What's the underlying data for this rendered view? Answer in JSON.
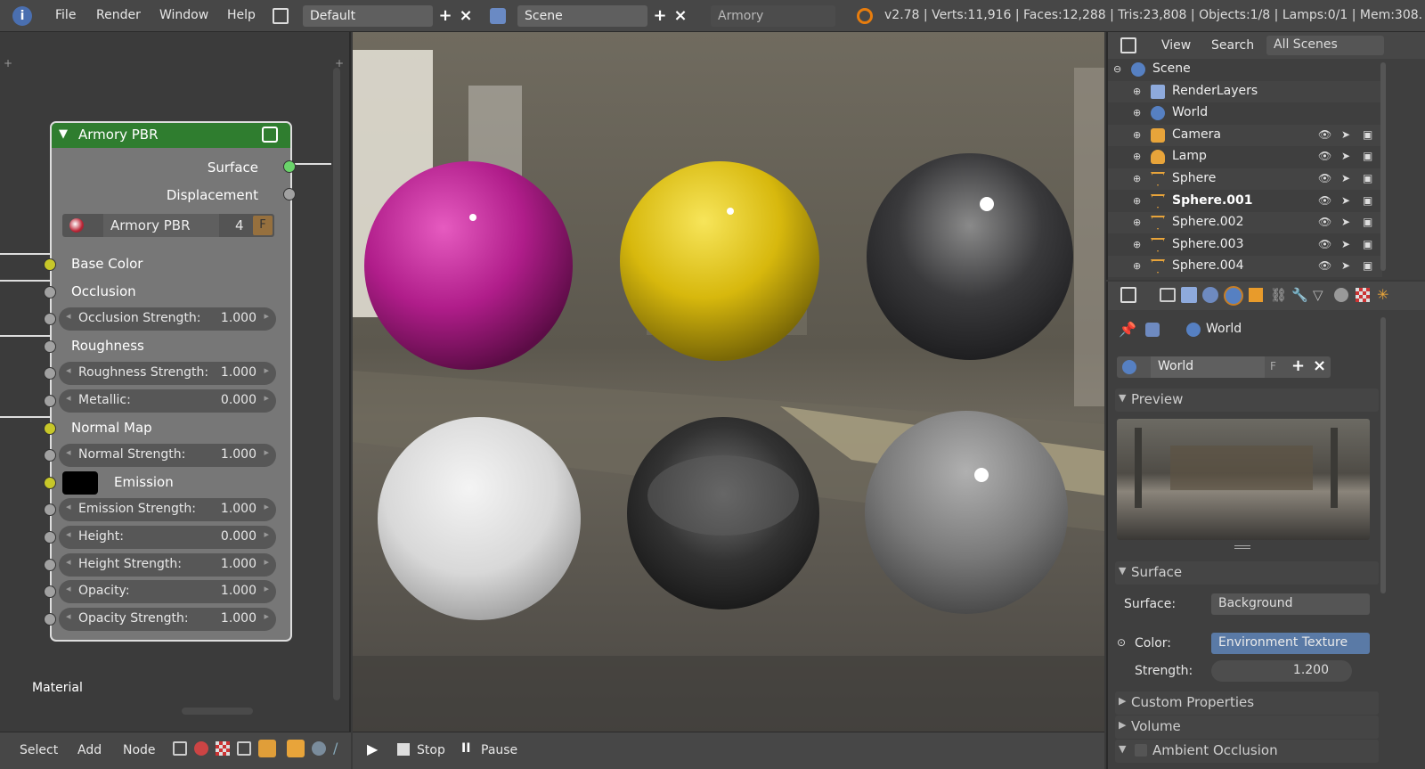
{
  "topbar": {
    "menus": [
      "File",
      "Render",
      "Window",
      "Help"
    ],
    "layout_name": "Default",
    "scene_name": "Scene",
    "engine": "Armory",
    "stats": "v2.78 | Verts:11,916 | Faces:12,288 | Tris:23,808 | Objects:1/8 | Lamps:0/1 | Mem:308."
  },
  "node": {
    "title": "Armory PBR",
    "outputs": [
      "Surface",
      "Displacement"
    ],
    "group_name": "Armory PBR",
    "group_users": "4",
    "fake_user": "F",
    "inputs": [
      {
        "label": "Base Color",
        "type": "socket"
      },
      {
        "label": "Occlusion",
        "type": "socket"
      },
      {
        "label": "Occlusion Strength:",
        "value": "1.000",
        "type": "field"
      },
      {
        "label": "Roughness",
        "type": "socket"
      },
      {
        "label": "Roughness Strength:",
        "value": "1.000",
        "type": "field"
      },
      {
        "label": "Metallic:",
        "value": "0.000",
        "type": "field"
      },
      {
        "label": "Normal Map",
        "type": "socket"
      },
      {
        "label": "Normal Strength:",
        "value": "1.000",
        "type": "field"
      },
      {
        "label": "Emission",
        "type": "color"
      },
      {
        "label": "Emission Strength:",
        "value": "1.000",
        "type": "field"
      },
      {
        "label": "Height:",
        "value": "0.000",
        "type": "field"
      },
      {
        "label": "Height Strength:",
        "value": "1.000",
        "type": "field"
      },
      {
        "label": "Opacity:",
        "value": "1.000",
        "type": "field"
      },
      {
        "label": "Opacity Strength:",
        "value": "1.000",
        "type": "field"
      }
    ],
    "frame_label": "Material"
  },
  "node_footer": {
    "menus": [
      "Select",
      "Add",
      "Node"
    ]
  },
  "viewport_footer": {
    "stop": "Stop",
    "pause": "Pause"
  },
  "outliner": {
    "menus": [
      "View",
      "Search",
      "All Scenes"
    ],
    "rows": [
      {
        "name": "Scene"
      },
      {
        "name": "RenderLayers"
      },
      {
        "name": "World"
      },
      {
        "name": "Camera"
      },
      {
        "name": "Lamp"
      },
      {
        "name": "Sphere"
      },
      {
        "name": "Sphere.001"
      },
      {
        "name": "Sphere.002"
      },
      {
        "name": "Sphere.003"
      },
      {
        "name": "Sphere.004"
      }
    ]
  },
  "properties": {
    "context_name": "World",
    "world_field": "World",
    "fake_user": "F",
    "panels": {
      "preview": "Preview",
      "surface": "Surface",
      "custom": "Custom Properties",
      "volume": "Volume",
      "ao": "Ambient Occlusion"
    },
    "surface_label": "Surface:",
    "surface_value": "Background",
    "color_label": "Color:",
    "color_value": "Environment Texture",
    "strength_label": "Strength:",
    "strength_value": "1.200"
  },
  "colors": {
    "node_header": "#2f7d2f",
    "socket_yellow": "#c7c729",
    "selection_blue": "#5680c2"
  },
  "spheres": [
    "magenta-glossy",
    "yellow-glossy",
    "clear-glass",
    "white-matte",
    "chrome-mirror",
    "grey-glossy"
  ]
}
